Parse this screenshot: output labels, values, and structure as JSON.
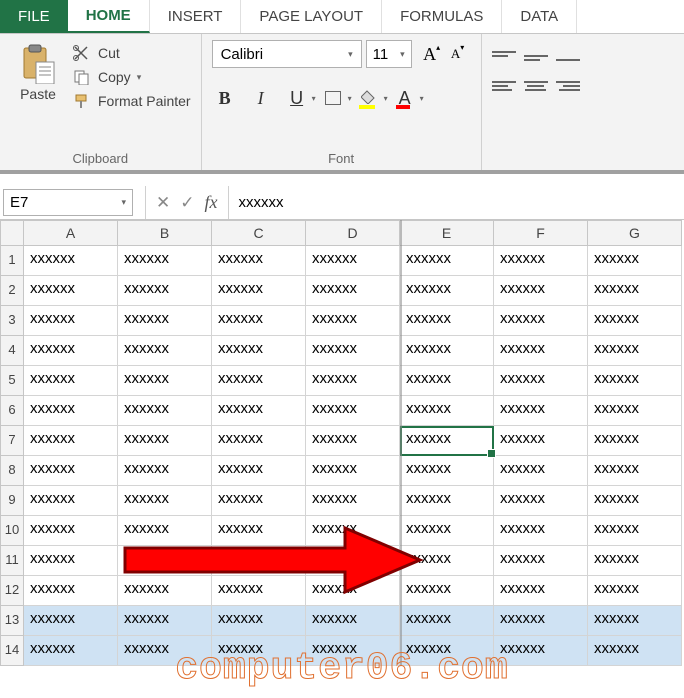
{
  "tabs": {
    "file": "FILE",
    "home": "HOME",
    "insert": "INSERT",
    "page_layout": "PAGE LAYOUT",
    "formulas": "FORMULAS",
    "data": "DATA",
    "active": "home"
  },
  "ribbon": {
    "clipboard": {
      "paste": "Paste",
      "cut": "Cut",
      "copy": "Copy",
      "format_painter": "Format Painter",
      "title": "Clipboard"
    },
    "font": {
      "name": "Calibri",
      "size": "11",
      "bold": "B",
      "italic": "I",
      "underline": "U",
      "font_color_label": "A",
      "title": "Font"
    }
  },
  "formula_bar": {
    "name_box": "E7",
    "cancel": "✕",
    "enter": "✓",
    "fx": "fx",
    "value": "xxxxxx"
  },
  "grid": {
    "columns": [
      "A",
      "B",
      "C",
      "D",
      "E",
      "F",
      "G"
    ],
    "row_numbers": [
      "1",
      "2",
      "3",
      "4",
      "5",
      "6",
      "7",
      "8",
      "9",
      "10",
      "11",
      "12",
      "13",
      "14"
    ],
    "cell_value": "xxxxxx",
    "active_cell": "E7",
    "selected_rows": [
      13,
      14
    ],
    "freeze_after_col": "D"
  },
  "watermark": "computer06.com"
}
